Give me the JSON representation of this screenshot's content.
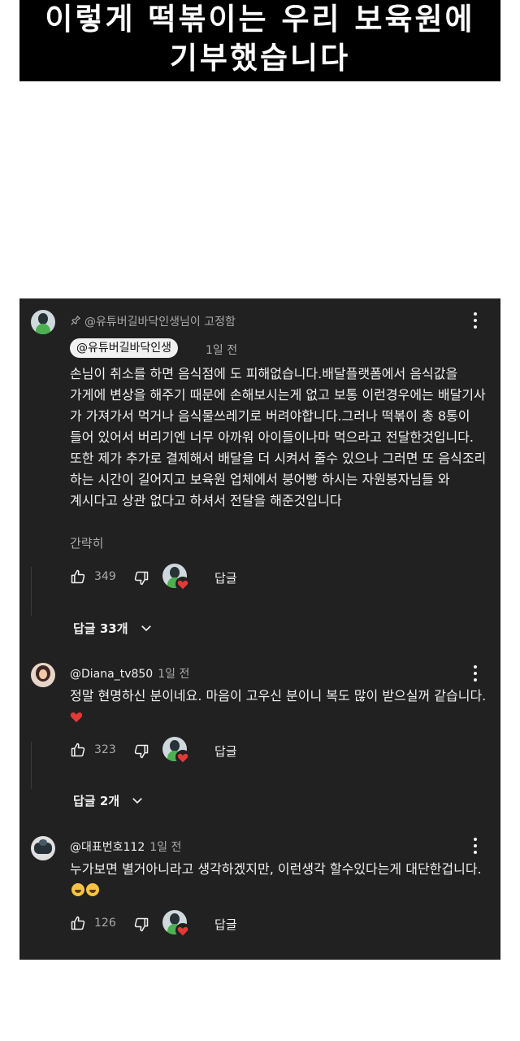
{
  "banner": {
    "line1": "이렇게 떡볶이는 우리 보육원에",
    "line2": "기부했습니다"
  },
  "pinned": {
    "pinned_label": "@유튜버길바닥인생님이 고정함",
    "handle": "@유튜버길바닥인생",
    "time": "1일 전",
    "text": "손님이 취소를 하면 음식점에 도 피해없습니다.배달플랫폼에서 음식값을 가게에 변상을 해주기 때문에 손해보시는게 없고 보통 이런경우에는 배달기사 가 가져가서 먹거나 음식물쓰레기로 버려야합니다.그러나 떡볶이 총 8통이 들어 있어서 버리기엔 너무 아까워 아이들이나마 먹으라고 전달한것입니다.또한 제가 추가로 결제해서 배달을 더 시켜서 줄수 있으나 그러면 또 음식조리 하는 시간이 길어지고 보육원 업체에서 붕어빵 하시는 자원봉자님들 와 계시다고 상관 없다고 하셔서 전달을 해준것입니다",
    "show_less": "간략히",
    "likes": "349",
    "reply_label": "답글",
    "replies_label": "답글 33개"
  },
  "comment2": {
    "handle": "@Diana_tv850",
    "time": "1일 전",
    "text": "정말 현명하신 분이네요. 마음이 고우신 분이니 복도 많이 받으실꺼 같습니다.",
    "likes": "323",
    "reply_label": "답글",
    "replies_label": "답글 2개"
  },
  "comment3": {
    "handle": "@대표번호112",
    "time": "1일 전",
    "text": "누가보면 별거아니라고 생각하겠지만, 이런생각 할수있다는게 대단한겁니다.",
    "likes": "126",
    "reply_label": "답글"
  },
  "colors": {
    "panel_bg": "#212121",
    "heart": "#e53935",
    "text": "#f1f1f1",
    "muted": "#aaaaaa"
  },
  "icons": [
    "pin-icon",
    "thumb-up-icon",
    "thumb-down-icon",
    "more-vert-icon",
    "chevron-down-icon",
    "heart-icon",
    "grinning-emoji-icon"
  ]
}
